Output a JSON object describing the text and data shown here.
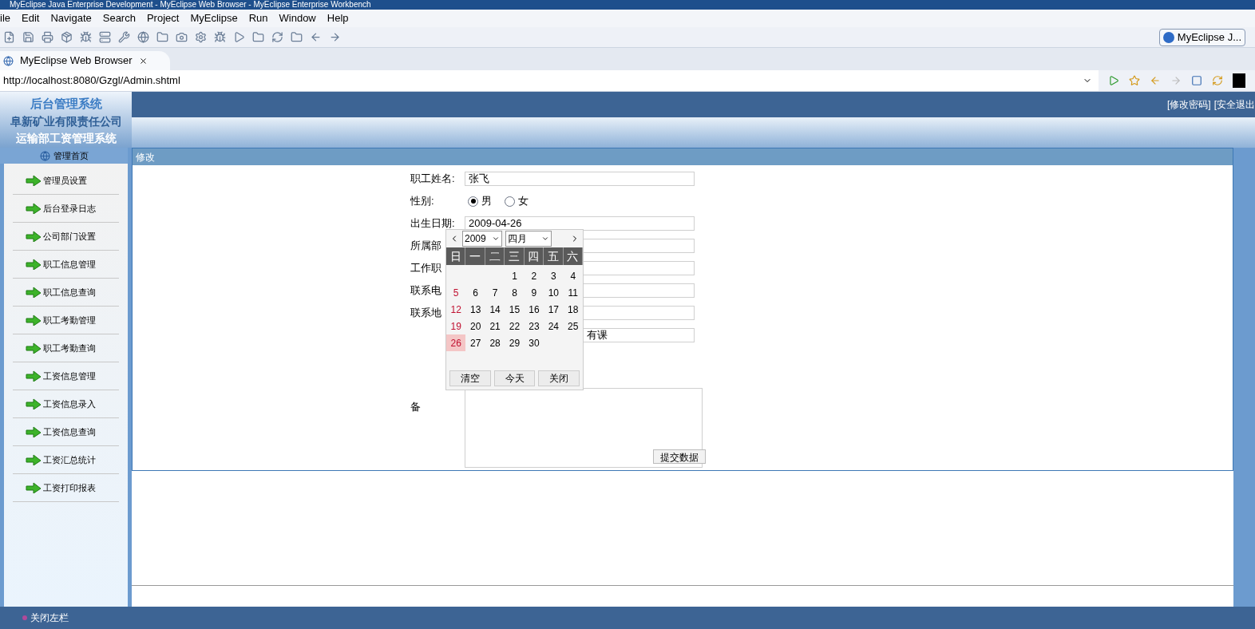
{
  "window": {
    "title": "MyEclipse Java Enterprise Development - MyEclipse Web Browser - MyEclipse Enterprise Workbench"
  },
  "menu": [
    "ile",
    "Edit",
    "Navigate",
    "Search",
    "Project",
    "MyEclipse",
    "Run",
    "Window",
    "Help"
  ],
  "perspective": {
    "label": "MyEclipse J..."
  },
  "editor_tab": {
    "label": "MyEclipse Web Browser",
    "selected": true
  },
  "address_bar": {
    "value": "http://localhost:8080/Gzgl/Admin.shtml"
  },
  "page": {
    "logo": "后台管理系统",
    "company": "阜新矿业有限责任公司",
    "system": "运输部工资管理系统",
    "home": "管理首页",
    "top_links": [
      "[修改密码]",
      "[安全退出"
    ],
    "sidebar": [
      {
        "label": "管理员设置"
      },
      {
        "label": "后台登录日志"
      },
      {
        "label": "公司部门设置"
      },
      {
        "label": "职工信息管理"
      },
      {
        "label": "职工信息查询"
      },
      {
        "label": "职工考勤管理"
      },
      {
        "label": "职工考勤查询"
      },
      {
        "label": "工资信息管理"
      },
      {
        "label": "工资信息录入"
      },
      {
        "label": "工资信息查询"
      },
      {
        "label": "工资汇总统计"
      },
      {
        "label": "工资打印报表"
      }
    ],
    "panel_title": "修改",
    "form": [
      {
        "kind": "text",
        "label": "职工姓名:",
        "value": "张飞"
      },
      {
        "kind": "radio",
        "label": "性别:",
        "options": [
          {
            "label": "男",
            "selected": true
          },
          {
            "label": "女",
            "selected": false
          }
        ]
      },
      {
        "kind": "text",
        "label": "出生日期:",
        "value": "2009-04-26"
      },
      {
        "kind": "text",
        "label": "所属部"
      },
      {
        "kind": "text",
        "label": "工作职"
      },
      {
        "kind": "text",
        "label": "联系电"
      },
      {
        "kind": "text",
        "label": "联系地"
      },
      {
        "kind": "tail",
        "value": "有课"
      },
      {
        "kind": "textarea",
        "label": "备"
      }
    ],
    "calendar": {
      "year": "2009",
      "month": "四月",
      "weekdays": [
        "日",
        "一",
        "二",
        "三",
        "四",
        "五",
        "六"
      ],
      "weeks": [
        [
          {
            "label": "1",
            "selected": false
          },
          {
            "label": "2",
            "selected": false
          },
          {
            "label": "3",
            "selected": false
          },
          {
            "label": "4",
            "selected": false
          }
        ],
        [
          {
            "label": "5",
            "selected": false
          },
          {
            "label": "6",
            "selected": false
          },
          {
            "label": "7",
            "selected": false
          },
          {
            "label": "8",
            "selected": false
          },
          {
            "label": "9",
            "selected": false
          },
          {
            "label": "10",
            "selected": false
          },
          {
            "label": "11",
            "selected": false
          }
        ],
        [
          {
            "label": "12",
            "selected": false
          },
          {
            "label": "13",
            "selected": false
          },
          {
            "label": "14",
            "selected": false
          },
          {
            "label": "15",
            "selected": false
          },
          {
            "label": "16",
            "selected": false
          },
          {
            "label": "17",
            "selected": false
          },
          {
            "label": "18",
            "selected": false
          }
        ],
        [
          {
            "label": "19",
            "selected": false
          },
          {
            "label": "20",
            "selected": false
          },
          {
            "label": "21",
            "selected": false
          },
          {
            "label": "22",
            "selected": false
          },
          {
            "label": "23",
            "selected": false
          },
          {
            "label": "24",
            "selected": false
          },
          {
            "label": "25",
            "selected": false
          }
        ],
        [
          {
            "label": "26",
            "selected": true
          },
          {
            "label": "27",
            "selected": false
          },
          {
            "label": "28",
            "selected": false
          },
          {
            "label": "29",
            "selected": false
          },
          {
            "label": "30",
            "selected": false
          }
        ]
      ],
      "buttons": [
        "清空",
        "今天",
        "关闭"
      ]
    },
    "submit": "提交数据",
    "footer": "关闭左栏"
  }
}
